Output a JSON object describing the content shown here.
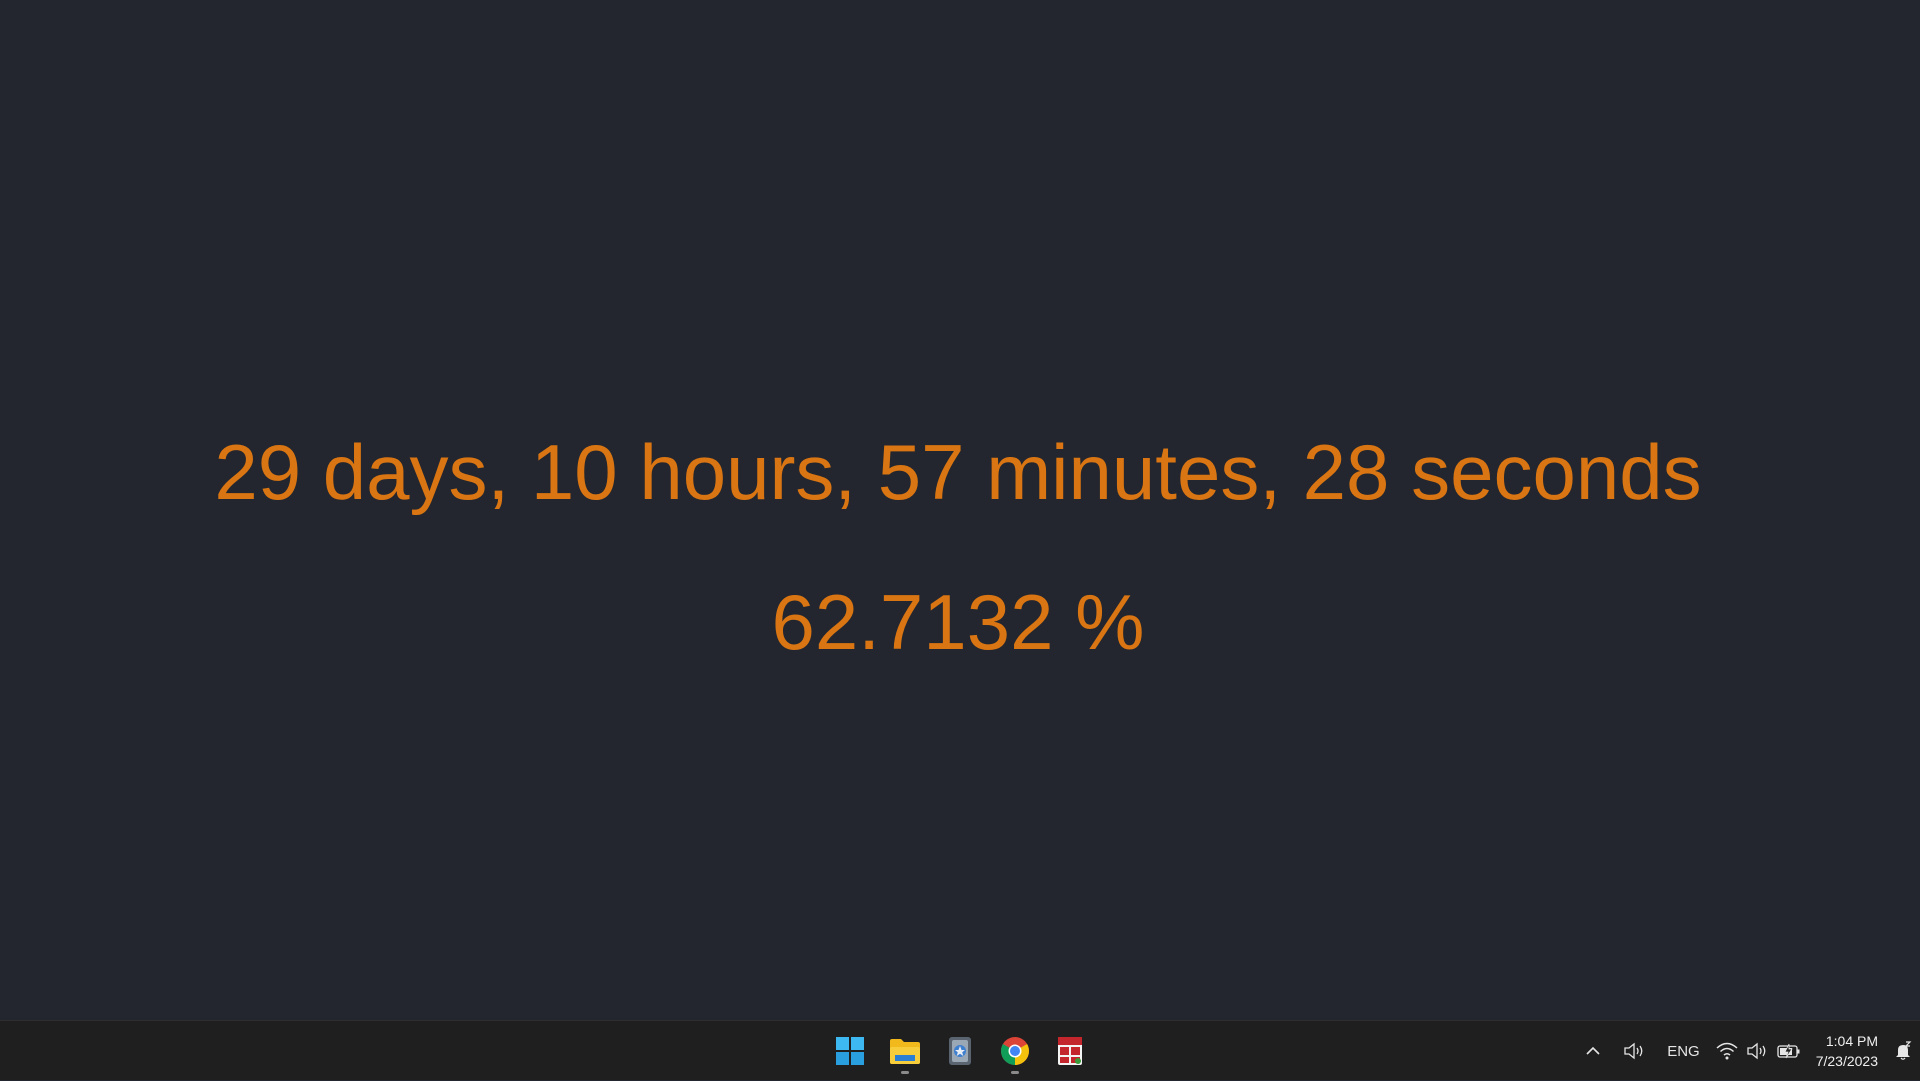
{
  "countdown": {
    "time_remaining": "29 days, 10 hours, 57 minutes, 28 seconds",
    "percent": "62.7132 %",
    "text_color": "#d97512",
    "background_color": "#23262e"
  },
  "taskbar": {
    "apps": [
      {
        "name": "start-button",
        "icon": "windows-logo-icon",
        "running": false
      },
      {
        "name": "file-explorer",
        "icon": "folder-icon",
        "running": true
      },
      {
        "name": "app-two",
        "icon": "app-tile-icon",
        "running": false
      },
      {
        "name": "chrome",
        "icon": "chrome-icon",
        "running": true
      },
      {
        "name": "app-four",
        "icon": "shield-app-icon",
        "running": false
      }
    ],
    "tray": {
      "overflow_icon": "chevron-up-icon",
      "speaker_icon": "speaker-icon",
      "language": "ENG",
      "wifi_icon": "wifi-icon",
      "volume_icon": "volume-icon",
      "battery_icon": "battery-charging-icon",
      "time": "1:04 PM",
      "date": "7/23/2023",
      "notification_icon": "notification-bell-icon"
    }
  }
}
